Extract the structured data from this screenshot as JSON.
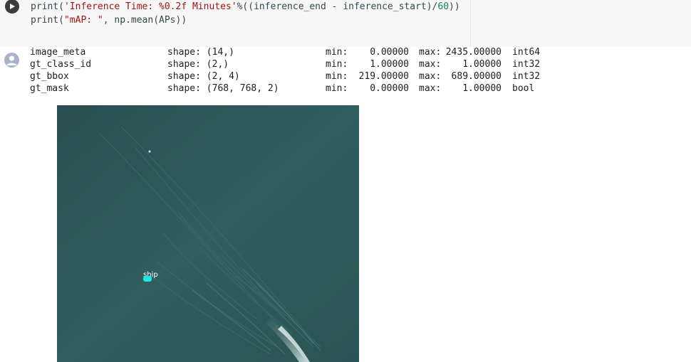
{
  "code_cell": {
    "line1": {
      "fn": "print(",
      "str": "'Inference Time: %0.2f Minutes'",
      "mid": "%((inference_end - inference_start)/",
      "num": "60",
      "end": "))"
    },
    "line2": {
      "fn": "print(",
      "str": "\"mAP: \"",
      "end": ", np.mean(APs))"
    }
  },
  "output": {
    "rows": [
      {
        "name": "image_meta",
        "shape": "shape: (14,)",
        "min_label": "min:",
        "min": "0.00000",
        "max_label": "max:",
        "max": "2435.00000",
        "dtype": "int64"
      },
      {
        "name": "gt_class_id",
        "shape": "shape: (2,)",
        "min_label": "min:",
        "min": "1.00000",
        "max_label": "max:",
        "max": "1.00000",
        "dtype": "int32"
      },
      {
        "name": "gt_bbox",
        "shape": "shape: (2, 4)",
        "min_label": "min:",
        "min": "219.00000",
        "max_label": "max:",
        "max": "689.00000",
        "dtype": "int32"
      },
      {
        "name": "gt_mask",
        "shape": "shape: (768, 768, 2)",
        "min_label": "min:",
        "min": "0.00000",
        "max_label": "max:",
        "max": "1.00000",
        "dtype": "bool"
      }
    ]
  },
  "image": {
    "detection_label": "ship",
    "water_color": "#2e5b5a",
    "mask_color": "#22e5e5"
  },
  "icons": {
    "run": "play-icon",
    "output_avatar": "user-avatar-icon"
  }
}
